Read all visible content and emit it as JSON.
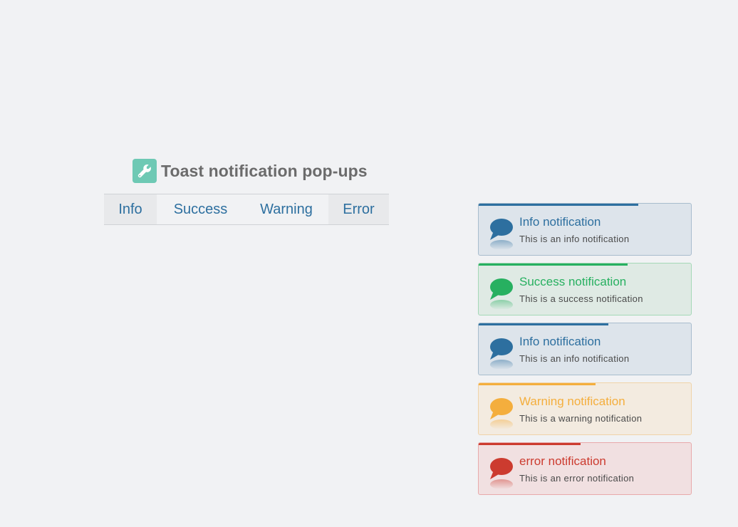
{
  "demo": {
    "title": "Toast notification pop-ups",
    "title_icon": "wrench-icon",
    "buttons": [
      {
        "label": "Info"
      },
      {
        "label": "Success"
      },
      {
        "label": "Warning"
      },
      {
        "label": "Error"
      }
    ]
  },
  "toasts": [
    {
      "type": "info",
      "title": "Info notification",
      "message": "This is an info notification",
      "icon": "speech-bubble-icon",
      "color": "#2d6f9f",
      "progress": 0.75
    },
    {
      "type": "success",
      "title": "Success notification",
      "message": "This is a success notification",
      "icon": "speech-bubble-icon",
      "color": "#27b060",
      "progress": 0.7
    },
    {
      "type": "info",
      "title": "Info notification",
      "message": "This is an info notification",
      "icon": "speech-bubble-icon",
      "color": "#2d6f9f",
      "progress": 0.61
    },
    {
      "type": "warning",
      "title": "Warning notification",
      "message": "This is a warning notification",
      "icon": "speech-bubble-icon",
      "color": "#f4ae3d",
      "progress": 0.55
    },
    {
      "type": "error",
      "title": "error notification",
      "message": "This is an error notification",
      "icon": "speech-bubble-icon",
      "color": "#cc3b2f",
      "progress": 0.48
    }
  ]
}
